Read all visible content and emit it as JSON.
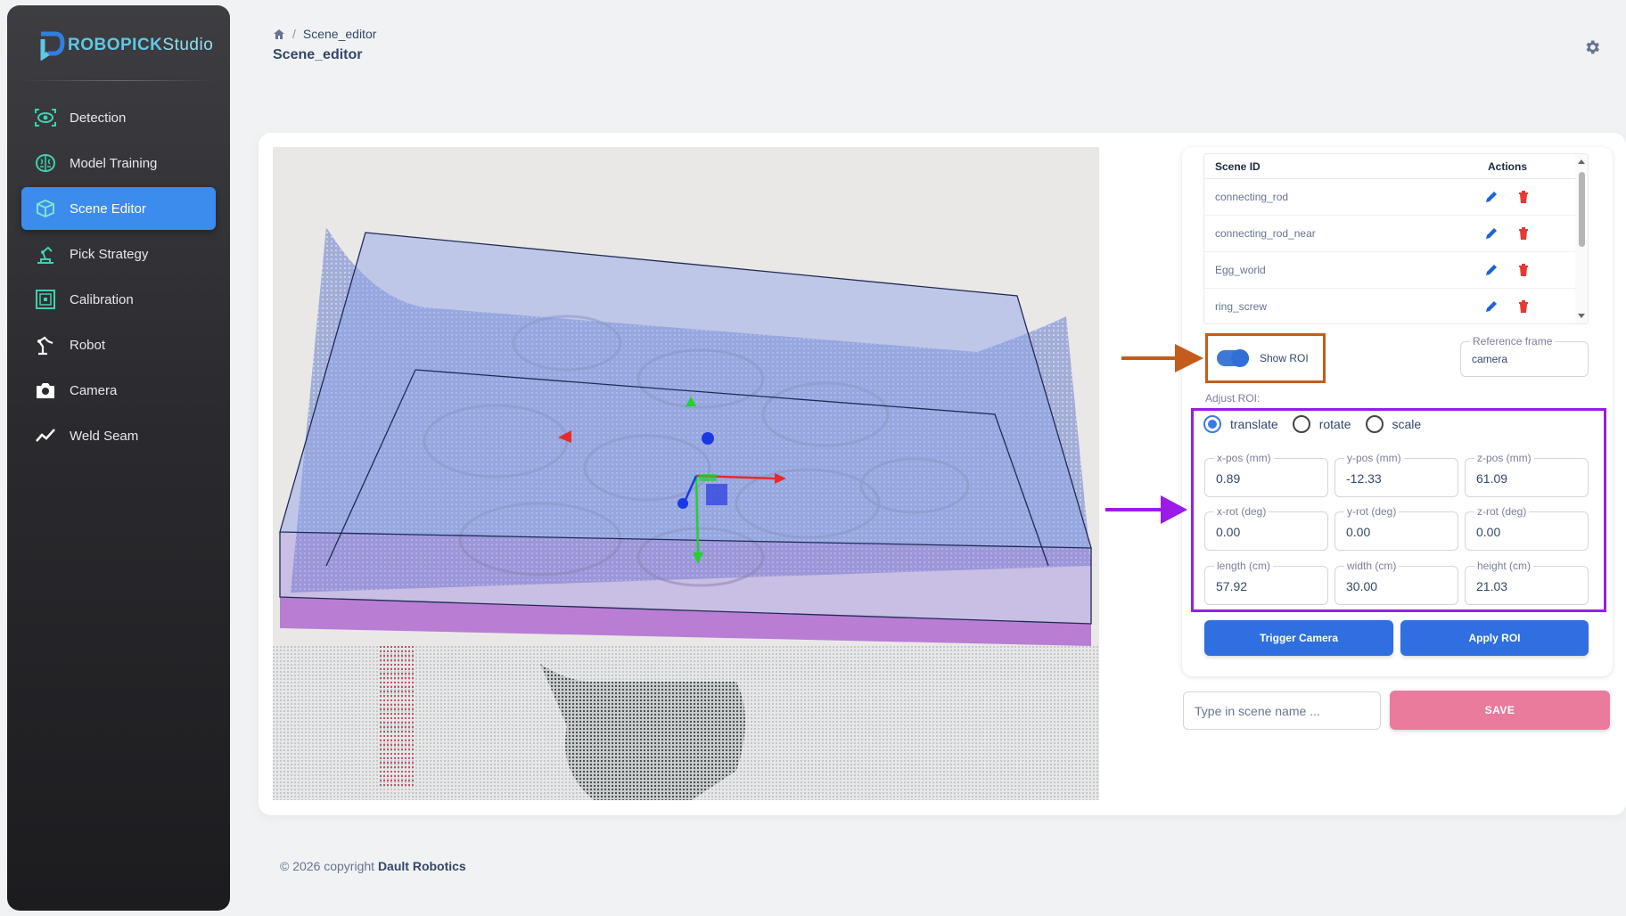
{
  "brand": {
    "name": "ROBOPICK",
    "suffix": "Studio"
  },
  "sidebar": {
    "items": [
      {
        "label": "Detection",
        "icon": "eye-scan-icon"
      },
      {
        "label": "Model Training",
        "icon": "brain-icon"
      },
      {
        "label": "Scene Editor",
        "icon": "cube-icon",
        "active": true
      },
      {
        "label": "Pick Strategy",
        "icon": "robot-arm-icon"
      },
      {
        "label": "Calibration",
        "icon": "target-square-icon"
      },
      {
        "label": "Robot",
        "icon": "robot-icon"
      },
      {
        "label": "Camera",
        "icon": "camera-icon"
      },
      {
        "label": "Weld Seam",
        "icon": "line-chart-icon"
      }
    ]
  },
  "header": {
    "breadcrumb_current": "Scene_editor",
    "title": "Scene_editor"
  },
  "scenes": {
    "col_id": "Scene ID",
    "col_actions": "Actions",
    "rows": [
      "connecting_rod",
      "connecting_rod_near",
      "Egg_world",
      "ring_screw"
    ]
  },
  "show_roi": {
    "label": "Show ROI",
    "enabled": true
  },
  "reference_frame": {
    "label": "Reference frame",
    "value": "camera"
  },
  "adjust": {
    "label": "Adjust ROI:",
    "modes": [
      "translate",
      "rotate",
      "scale"
    ],
    "selected": "translate"
  },
  "roi_fields": {
    "xpos": {
      "label": "x-pos (mm)",
      "value": "0.89"
    },
    "ypos": {
      "label": "y-pos (mm)",
      "value": "-12.33"
    },
    "zpos": {
      "label": "z-pos (mm)",
      "value": "61.09"
    },
    "xrot": {
      "label": "x-rot (deg)",
      "value": "0.00"
    },
    "yrot": {
      "label": "y-rot (deg)",
      "value": "0.00"
    },
    "zrot": {
      "label": "z-rot (deg)",
      "value": "0.00"
    },
    "length": {
      "label": "length (cm)",
      "value": "57.92"
    },
    "width": {
      "label": "width (cm)",
      "value": "30.00"
    },
    "height": {
      "label": "height (cm)",
      "value": "21.03"
    }
  },
  "buttons": {
    "trigger_camera": "Trigger Camera",
    "apply_roi": "Apply ROI",
    "save": "SAVE"
  },
  "scene_name": {
    "placeholder": "Type in scene name ..."
  },
  "footer": {
    "text": "© 2026 copyright",
    "company": "Dault Robotics"
  },
  "colors": {
    "accent": "#3c8ced",
    "delete": "#e53935",
    "edit": "#1e63d6",
    "save": "#eb7b9c",
    "highlight_orange": "#c45c1b",
    "highlight_purple": "#9a1ce6"
  }
}
